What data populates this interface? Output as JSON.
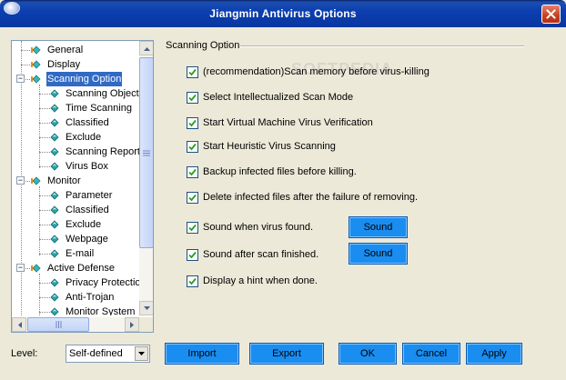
{
  "window": {
    "title": "Jiangmin Antivirus Options"
  },
  "tree": {
    "items": [
      {
        "label": "General"
      },
      {
        "label": "Display"
      },
      {
        "label": "Scanning Option"
      },
      {
        "label": "Scanning Object"
      },
      {
        "label": "Time Scanning"
      },
      {
        "label": "Classified"
      },
      {
        "label": "Exclude"
      },
      {
        "label": "Scanning Report"
      },
      {
        "label": "Virus Box"
      },
      {
        "label": "Monitor"
      },
      {
        "label": "Parameter"
      },
      {
        "label": "Classified"
      },
      {
        "label": "Exclude"
      },
      {
        "label": "Webpage"
      },
      {
        "label": "E-mail"
      },
      {
        "label": "Active Defense"
      },
      {
        "label": "Privacy Protectio"
      },
      {
        "label": "Anti-Trojan"
      },
      {
        "label": "Monitor System"
      }
    ],
    "selected": "Scanning Option"
  },
  "section": {
    "title": "Scanning Option"
  },
  "options": [
    {
      "label": "(recommendation)Scan memory before virus-killing",
      "checked": true
    },
    {
      "label": "Select Intellectualized Scan Mode",
      "checked": true
    },
    {
      "label": "Start Virtual Machine Virus Verification",
      "checked": true
    },
    {
      "label": "Start Heuristic Virus Scanning",
      "checked": true
    },
    {
      "label": "Backup infected files before killing.",
      "checked": true
    },
    {
      "label": "Delete infected files after the failure of removing.",
      "checked": true
    },
    {
      "label": "Sound when virus found.",
      "checked": true
    },
    {
      "label": "Sound after scan finished.",
      "checked": true
    },
    {
      "label": "Display a hint when done.",
      "checked": true
    }
  ],
  "sound_buttons": [
    {
      "label": "Sound"
    },
    {
      "label": "Sound"
    }
  ],
  "bottom": {
    "level_label": "Level:",
    "level_value": "Self-defined",
    "import_label": "Import",
    "export_label": "Export",
    "ok_label": "OK",
    "cancel_label": "Cancel",
    "apply_label": "Apply"
  },
  "watermark": "SOFTPEDIA",
  "colors": {
    "title_bar": "#0b3fb0",
    "selection": "#316ac5",
    "button_blue": "#1a8df0",
    "window_bg": "#ece9d8",
    "node_orange": "#f28c1a",
    "node_teal": "#2aa3a8"
  },
  "icons": {
    "app": "jiangmin-app-icon",
    "close": "close-icon",
    "tree_node_top": "orange-node-icon",
    "tree_node_child": "teal-diamond-icon",
    "checkbox": "checkmark-icon"
  }
}
